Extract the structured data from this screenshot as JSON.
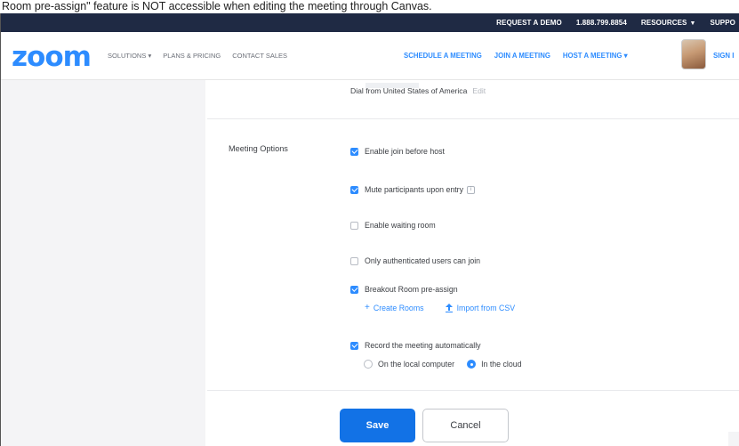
{
  "caption": "Room pre-assign\" feature is NOT accessible when editing the meeting through Canvas.",
  "topbar": {
    "request_demo": "REQUEST A DEMO",
    "phone": "1.888.799.8854",
    "resources": "RESOURCES",
    "support": "SUPPO"
  },
  "nav": {
    "logo": "zoom",
    "solutions": "SOLUTIONS",
    "plans": "PLANS & PRICING",
    "contact": "CONTACT SALES",
    "schedule": "SCHEDULE A MEETING",
    "join": "JOIN A MEETING",
    "host": "HOST A MEETING",
    "signin": "SIGN I"
  },
  "dial": {
    "text": "Dial from United States of America",
    "edit": "Edit"
  },
  "meeting_options": {
    "label": "Meeting Options",
    "options": [
      {
        "label": "Enable join before host",
        "checked": true
      },
      {
        "label": "Mute participants upon entry",
        "checked": true
      },
      {
        "label": "Enable waiting room",
        "checked": false
      },
      {
        "label": "Only authenticated users can join",
        "checked": false
      },
      {
        "label": "Breakout Room pre-assign",
        "checked": true
      },
      {
        "label": "Record the meeting automatically",
        "checked": true
      }
    ],
    "create_rooms": "Create Rooms",
    "import_csv": "Import from CSV",
    "record_local": "On the local computer",
    "record_cloud": "In the cloud",
    "record_selected": "In the cloud"
  },
  "buttons": {
    "save": "Save",
    "cancel": "Cancel"
  },
  "colors": {
    "brand": "#2D8CFF",
    "topbar": "#1f2a44",
    "save": "#1272e6"
  }
}
